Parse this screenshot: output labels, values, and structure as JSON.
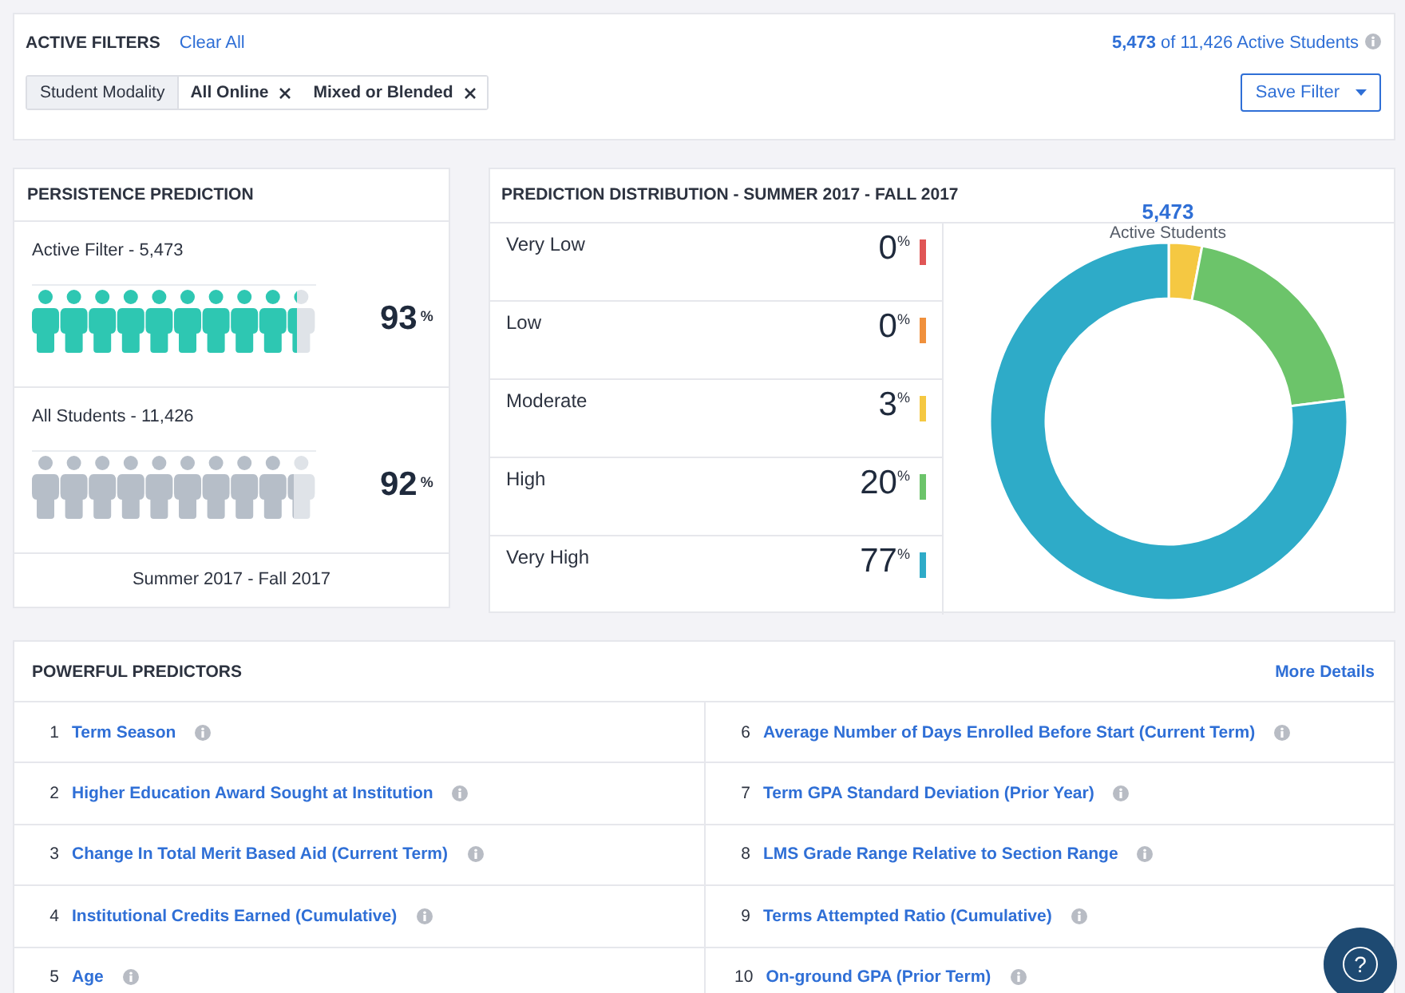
{
  "filters": {
    "title": "ACTIVE FILTERS",
    "clear": "Clear All",
    "count": "**5,473** of 11,426 Active Students",
    "facet": "Student Modality",
    "chips": [
      {
        "label": "All Online"
      },
      {
        "label": "Mixed or Blended"
      }
    ],
    "save": "Save Filter"
  },
  "persistence": {
    "title": "PERSISTENCE PREDICTION",
    "groups": [
      {
        "label": "Active Filter - 5,473",
        "kind": "filter",
        "value": "93",
        "unit": "%",
        "level": 0.93
      },
      {
        "label": "All Students - 11,426",
        "kind": "all",
        "value": "92",
        "unit": "%",
        "level": 0.92
      }
    ],
    "footer": "Summer 2017 - Fall 2017"
  },
  "distribution": {
    "title": "PREDICTION DISTRIBUTION - SUMMER 2017 - FALL 2017",
    "rows": [
      {
        "value": "0",
        "unit": "%",
        "color": "#e05555"
      },
      {
        "value": "0",
        "unit": "%",
        "color": "#f0903c"
      },
      {
        "value": "3",
        "unit": "%",
        "color": "#f5c842"
      },
      {
        "value": "20",
        "unit": "%",
        "color": "#6cc46a"
      },
      {
        "value": "77",
        "unit": "%",
        "color": "#2eabc8"
      }
    ],
    "center_value": "5,473",
    "center_label": "Active Students",
    "chart_data": {
      "type": "donut",
      "categories": [
        "Very Low",
        "Low",
        "Moderate",
        "High",
        "Very High"
      ],
      "values": [
        0,
        0,
        3,
        20,
        77
      ]
    }
  },
  "predictors": {
    "title": "POWERFUL PREDICTORS",
    "more": "More Details",
    "items": [
      {
        "rank": "1",
        "label": "Term Season"
      },
      {
        "rank": "2",
        "label": "Higher Education Award Sought at Institution"
      },
      {
        "rank": "3",
        "label": "Change In Total Merit Based Aid (Current Term)"
      },
      {
        "rank": "4",
        "label": "Institutional Credits Earned (Cumulative)"
      },
      {
        "rank": "5",
        "label": "Age"
      },
      {
        "rank": "6",
        "label": "Average Number of Days Enrolled Before Start (Current Term)"
      },
      {
        "rank": "7",
        "label": "Term GPA Standard Deviation (Prior Year)"
      },
      {
        "rank": "8",
        "label": "LMS Grade Range Relative to Section Range"
      },
      {
        "rank": "9",
        "label": "Terms Attempted Ratio (Cumulative)"
      },
      {
        "rank": "10",
        "label": "On-ground GPA (Prior Term)"
      }
    ]
  },
  "help": {
    "label": "?"
  }
}
